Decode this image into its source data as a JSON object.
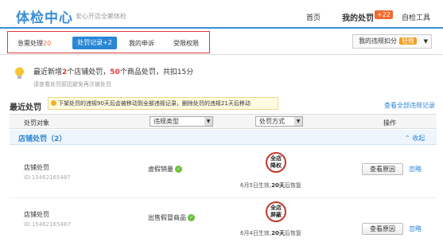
{
  "header": {
    "brand": "体检中心",
    "slogan": "安心开店全赖体检",
    "nav_home": "首页",
    "nav_mine": "我的处罚",
    "nav_badge": "+22",
    "nav_tools": "自检工具"
  },
  "tabs": {
    "urgent_label": "急需处理",
    "urgent_count": "20",
    "records": "处罚记录+2",
    "appeal": "我的申诉",
    "restrict": "受限权限"
  },
  "score": {
    "label": "我的违规扣分",
    "level": "轻微",
    "arrow": "▼"
  },
  "notice": {
    "p1": "最近新增",
    "n1": "2",
    "p2": "个店铺处罚，",
    "n2": "50",
    "p3": "个商品处罚，共扣15分",
    "sub": "请查看处罚原因避免再次被处罚"
  },
  "section": {
    "title": "最近处罚",
    "tip": "下架处罚的违规90天后会被移动到全部违规记录，删除处罚的违规21天后移动",
    "view_all": "查看全部违规记录"
  },
  "table": {
    "col_object": "处罚对象",
    "filter_type": "违规类型",
    "filter_method": "处罚方式",
    "col_action": "操作",
    "dd": "▼"
  },
  "group": {
    "title": "店铺处罚（2）",
    "toggle": "⌃ 收起"
  },
  "rows": [
    {
      "name": "店铺处罚",
      "id": "ID:15462165487",
      "type": "虚假销量",
      "stamp_l1": "全店",
      "stamp_l2": "降权",
      "eff_date": "6月5日生效,",
      "eff_days": "20天",
      "eff_tail": "后恢复",
      "btn": "查看原因",
      "ignore": "忽略"
    },
    {
      "name": "店铺处罚",
      "id": "ID:15462165487",
      "type": "出售假冒商品",
      "stamp_l1": "全店",
      "stamp_l2": "屏蔽",
      "eff_date": "6月4日生效,",
      "eff_days": "20天",
      "eff_tail": "后恢复",
      "btn": "查看原因",
      "ignore": "忽略"
    }
  ],
  "colors": {
    "accent": "#3a8ed5",
    "active_tab": "#2a86d5",
    "highlight_box": "#e03a3a",
    "badge": "#f26b2f"
  }
}
